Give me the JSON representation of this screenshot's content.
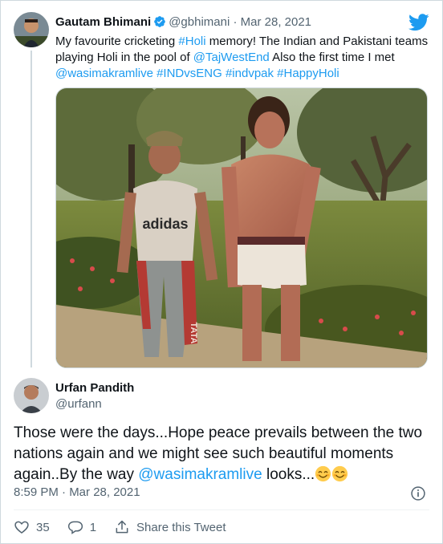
{
  "quoted_tweet": {
    "author_name": "Gautam Bhimani",
    "handle": "@gbhimani",
    "separator": "·",
    "date": "Mar 28, 2021",
    "text_segments": [
      {
        "text": "My favourite cricketing ",
        "link": false
      },
      {
        "text": "#Holi",
        "link": true
      },
      {
        "text": " memory! The Indian and Pakistani teams playing Holi in the pool of ",
        "link": false
      },
      {
        "text": "@TajWestEnd",
        "link": true
      },
      {
        "text": " Also the first time I met ",
        "link": false
      },
      {
        "text": "@wasimakramlive",
        "link": true
      },
      {
        "text": " ",
        "link": false
      },
      {
        "text": "#INDvsENG",
        "link": true
      },
      {
        "text": " ",
        "link": false
      },
      {
        "text": "#indvpak",
        "link": true
      },
      {
        "text": " ",
        "link": false
      },
      {
        "text": "#HappyHoli",
        "link": true
      }
    ],
    "photo_shirt_text": "adidas",
    "photo_pants_text": "TATA"
  },
  "tweet": {
    "author_name": "Urfan Pandith",
    "handle": "@urfann",
    "text_segments": [
      {
        "text": "Those were the days...Hope peace prevails between the two nations again and we might see such beautiful moments again..By the way ",
        "link": false
      },
      {
        "text": "@wasimakramlive",
        "link": true
      },
      {
        "text": " looks...",
        "link": false
      }
    ],
    "emojis": [
      "smiling-face-with-smiling-eyes",
      "smiling-face-with-smiling-eyes"
    ],
    "timestamp": "8:59 PM · Mar 28, 2021"
  },
  "actions": {
    "like_count": "35",
    "reply_count": "1",
    "share_label": "Share this Tweet"
  },
  "colors": {
    "link": "#1d9bf0",
    "muted": "#536471",
    "text": "#0f1419",
    "border": "#cfd9de"
  }
}
